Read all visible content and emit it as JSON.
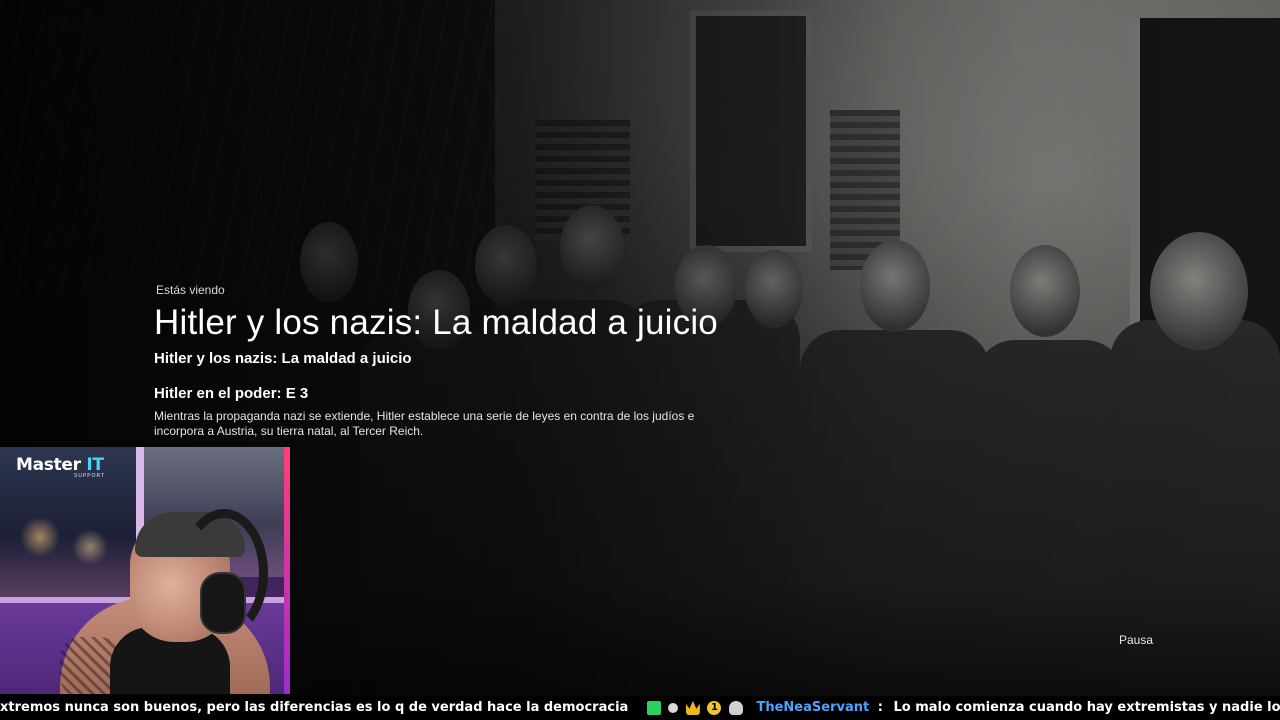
{
  "player": {
    "watching_label": "Estás viendo",
    "title": "Hitler y los nazis: La maldad a juicio",
    "series_title": "Hitler y los nazis: La maldad a juicio",
    "episode_title": "Hitler en el poder: E 3",
    "synopsis": "Mientras la propaganda nazi se extiende, Hitler establece una serie de leyes en contra de los judíos e incorpora a Austria, su tierra natal, al Tercer Reich.",
    "pause_label": "Pausa"
  },
  "overlay_logo": {
    "brand": "Master",
    "brand_accent": "IT",
    "tagline": "SUPPORT"
  },
  "chat_ticker": {
    "previous_message_tail": "xtremos nunca son buenos, pero las diferencias es lo q de verdad hace la democracia",
    "badges": [
      "kick-badge",
      "moon-badge",
      "crown-badge",
      "one-month-badge",
      "avatar-badge"
    ],
    "badge_number": "1",
    "username": "TheNeaServant",
    "separator": ":",
    "message": "Lo malo comienza cuando hay extremistas y nadie los detiene"
  },
  "colors": {
    "username": "#4da3ff",
    "logo_accent": "#49d3ff",
    "cam_wall": "#5a2e79"
  }
}
